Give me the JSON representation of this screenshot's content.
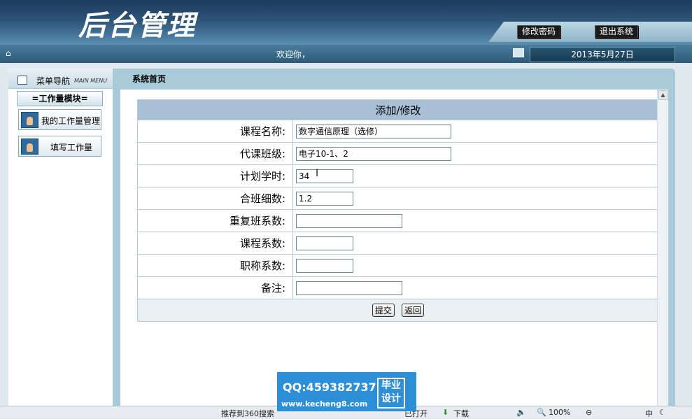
{
  "header": {
    "logo_text": "后台管理",
    "change_password": "修改密码",
    "logout": "退出系统"
  },
  "welcome_bar": {
    "welcome": "欢迎你，",
    "date": "2013年5月27日"
  },
  "left_nav": {
    "title": "菜单导航",
    "subtitle": "MAIN MENU",
    "module_title": "=工作量模块=",
    "items": [
      {
        "label": "我的工作量管理",
        "icon": "user-icon"
      },
      {
        "label": "填写工作量",
        "icon": "user-icon"
      }
    ]
  },
  "tab_title": "系统首页",
  "form": {
    "caption": "添加/修改",
    "fields": [
      {
        "label": "课程名称:",
        "value": "数字通信原理（选修）"
      },
      {
        "label": "代课班级:",
        "value": "电子10-1、2"
      },
      {
        "label": "计划学时:",
        "value": "34"
      },
      {
        "label": "合班细数:",
        "value": "1.2"
      },
      {
        "label": "重复班系数:",
        "value": ""
      },
      {
        "label": "课程系数:",
        "value": ""
      },
      {
        "label": "职称系数:",
        "value": ""
      },
      {
        "label": "备注:",
        "value": ""
      }
    ],
    "submit": "提交",
    "back": "返回"
  },
  "watermark": {
    "qq": "QQ:459382737",
    "site": "www.kecheng8.com",
    "badge_line1": "毕业",
    "badge_line2": "设计"
  },
  "statusbar": {
    "recommend": "推荐到360搜索",
    "open": "已打开",
    "download": "下载",
    "zoom": "100%",
    "ime": "中"
  }
}
